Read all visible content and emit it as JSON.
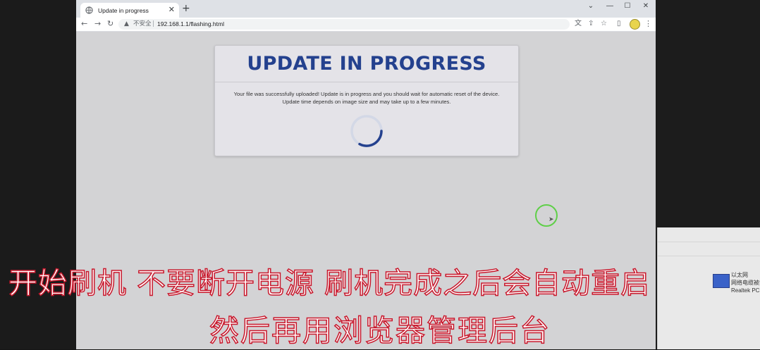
{
  "browser": {
    "tab_title": "Update in progress",
    "tab_close": "✕",
    "new_tab": "+",
    "window_controls": {
      "chevron": "⌄",
      "minimize": "—",
      "maximize": "☐",
      "close": "✕"
    },
    "nav": {
      "back": "←",
      "forward": "→",
      "reload": "↻"
    },
    "address": {
      "security_label": "不安全",
      "separator": "|",
      "url": "192.168.1.1/flashing.html"
    },
    "toolbar_icons": {
      "translate": "文",
      "share": "⇪",
      "bookmark": "☆",
      "sidepanel": "▯",
      "menu": "⋮"
    }
  },
  "page": {
    "title": "UPDATE IN PROGRESS",
    "message_line1": "Your file was successfully uploaded! Update is in progress and you should wait for automatic reset of the device.",
    "message_line2": "Update time depends on image size and may take up to a few minutes."
  },
  "desktop": {
    "network_line1": "以太网",
    "network_line2": "网络电缆被拔",
    "network_line3": "Realtek PCIe"
  },
  "subtitles": {
    "line1": "开始刷机 不要断开电源 刷机完成之后会自动重启",
    "line2": "然后再用浏览器管理后台"
  },
  "colors": {
    "title": "#24418e",
    "spinner_track": "#d3d8e6",
    "spinner_arc": "#24418e",
    "subtitle_stroke": "#c8182c",
    "cursor_ring": "#5fcf48"
  }
}
